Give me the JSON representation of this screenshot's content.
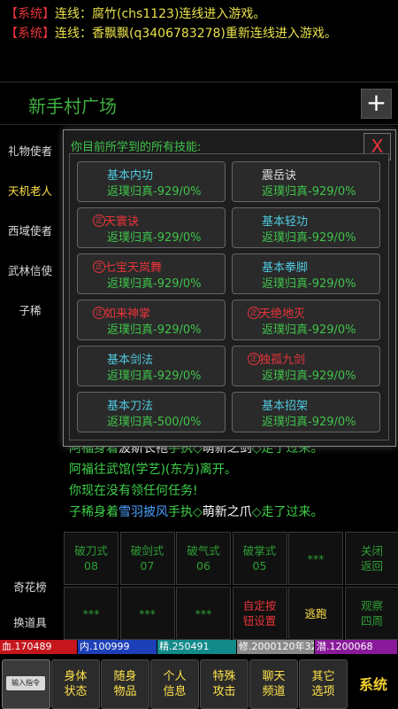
{
  "system_messages": [
    {
      "tag": "【系统】",
      "text": "连线：腐竹(chs1123)连线进入游戏。"
    },
    {
      "tag": "【系统】",
      "text": "连线：香飘飘(q3406783278)重新连线进入游戏。"
    }
  ],
  "location": {
    "title": "新手村广场",
    "plus": "+"
  },
  "npcs": [
    "礼物使者",
    "天机老人",
    "西域使者",
    "武林信使",
    "子稀"
  ],
  "room_text": {
    "line1": {
      "a": "阿福身着",
      "b": "波斯长袍",
      "c": "手执◇",
      "d": "萌新之剑",
      "e": "◇走了过来。"
    },
    "line2": "阿福往武馆(学艺)(东方)离开。",
    "line3": "你现在没有领任何任务!",
    "line4": {
      "a": "子稀身着",
      "b": "雪羽披风",
      "c": "手执◇",
      "d": "萌新之爪",
      "e": "◇走了过来。"
    }
  },
  "dialog": {
    "title": "你目前所学到的所有技能:",
    "close": "X",
    "zh_mark": "正",
    "skills": [
      {
        "name": "基本内功",
        "value": "返璞归真-929/0%",
        "color": "cyan",
        "mark": false
      },
      {
        "name": "震岳诀",
        "value": "返璞归真-929/0%",
        "color": "gray",
        "mark": false
      },
      {
        "name": "天寰诀",
        "value": "返璞归真-929/0%",
        "color": "red",
        "mark": true
      },
      {
        "name": "基本轻功",
        "value": "返璞归真-929/0%",
        "color": "cyan",
        "mark": false
      },
      {
        "name": "七宝天岚舞",
        "value": "返璞归真-929/0%",
        "color": "red",
        "mark": true
      },
      {
        "name": "基本拳脚",
        "value": "返璞归真-929/0%",
        "color": "cyan",
        "mark": false
      },
      {
        "name": "如来神掌",
        "value": "返璞归真-929/0%",
        "color": "red",
        "mark": true
      },
      {
        "name": "天绝地灭",
        "value": "返璞归真-929/0%",
        "color": "red",
        "mark": true
      },
      {
        "name": "基本剑法",
        "value": "返璞归真-929/0%",
        "color": "cyan",
        "mark": false
      },
      {
        "name": "独孤九剑",
        "value": "返璞归真-929/0%",
        "color": "red",
        "mark": true
      },
      {
        "name": "基本刀法",
        "value": "返璞归真-500/0%",
        "color": "cyan",
        "mark": false
      },
      {
        "name": "基本招架",
        "value": "返璞归真-929/0%",
        "color": "cyan",
        "mark": false
      }
    ]
  },
  "side_buttons": [
    "奇花榜",
    "换道具"
  ],
  "grid": [
    {
      "l1": "破刀式",
      "l2": "08",
      "color": "dgreen"
    },
    {
      "l1": "破剑式",
      "l2": "07",
      "color": "dgreen"
    },
    {
      "l1": "破气式",
      "l2": "06",
      "color": "dgreen"
    },
    {
      "l1": "破掌式",
      "l2": "05",
      "color": "dgreen"
    },
    {
      "l1": "***",
      "l2": "",
      "color": "dgreen"
    },
    {
      "l1": "关闭",
      "l2": "返回",
      "color": "dgreen"
    },
    {
      "l1": "***",
      "l2": "",
      "color": "dgreen"
    },
    {
      "l1": "***",
      "l2": "",
      "color": "dgreen"
    },
    {
      "l1": "***",
      "l2": "",
      "color": "dgreen"
    },
    {
      "l1": "自定按",
      "l2": "钮设置",
      "color": "red"
    },
    {
      "l1": "逃跑",
      "l2": "",
      "color": "yellow"
    },
    {
      "l1": "观察",
      "l2": "四周",
      "color": "dgreen"
    }
  ],
  "stats": [
    {
      "label": "血.170489",
      "color": "#c4161c"
    },
    {
      "label": "内.100999",
      "color": "#1d3fb8"
    },
    {
      "label": "精.250491",
      "color": "#128a8a"
    },
    {
      "label": "修.2000120年32",
      "color": "#8a8a8a"
    },
    {
      "label": "潜.1200068",
      "color": "#8a1a9a"
    }
  ],
  "bottom_menu": {
    "input_label": "输入指令",
    "items": [
      {
        "l1": "身体",
        "l2": "状态"
      },
      {
        "l1": "随身",
        "l2": "物品"
      },
      {
        "l1": "个人",
        "l2": "信息"
      },
      {
        "l1": "特殊",
        "l2": "攻击"
      },
      {
        "l1": "聊天",
        "l2": "频道"
      },
      {
        "l1": "其它",
        "l2": "选项"
      }
    ],
    "system": "系统"
  }
}
